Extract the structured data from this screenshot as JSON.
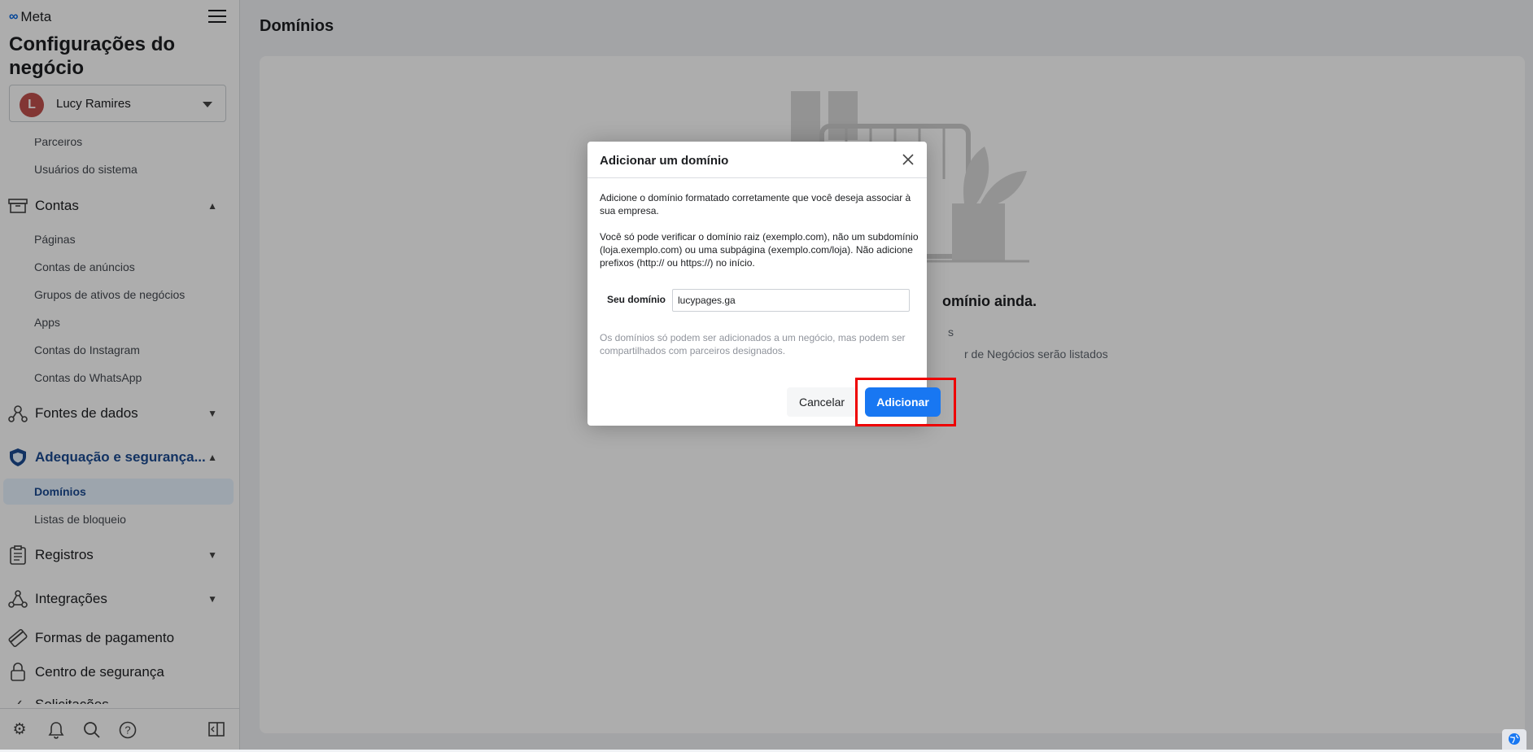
{
  "brand": {
    "name": "Meta",
    "logo_glyph": "∞"
  },
  "sidebar": {
    "title": "Configurações do negócio",
    "account": {
      "initial": "L",
      "name": "Lucy Ramires"
    },
    "items": {
      "parceiros": "Parceiros",
      "usuarios_sistema": "Usuários do sistema",
      "contas": "Contas",
      "paginas": "Páginas",
      "contas_anuncios": "Contas de anúncios",
      "grupos_ativos": "Grupos de ativos de negócios",
      "apps": "Apps",
      "contas_instagram": "Contas do Instagram",
      "contas_whatsapp": "Contas do WhatsApp",
      "fontes_dados": "Fontes de dados",
      "adequacao": "Adequação e segurança...",
      "dominios": "Domínios",
      "listas_bloqueio": "Listas de bloqueio",
      "registros": "Registros",
      "integracoes": "Integrações",
      "formas_pagamento": "Formas de pagamento",
      "centro_seguranca": "Centro de segurança",
      "solicitacoes": "Solicitações"
    },
    "icons": {
      "contas": "archive-icon",
      "fontes_dados": "data-sources-icon",
      "adequacao": "shield-icon",
      "registros": "clipboard-icon",
      "integracoes": "integrations-icon",
      "formas_pagamento": "credit-card-icon",
      "centro_seguranca": "lock-icon"
    }
  },
  "main": {
    "title": "Domínios",
    "empty_state": {
      "heading": "omínio ainda.",
      "line1": "s",
      "line2": "r de Negócios serão listados"
    }
  },
  "modal": {
    "title": "Adicionar um domínio",
    "paragraph1": "Adicione o domínio formatado corretamente que você deseja associar à sua empresa.",
    "paragraph2": "Você só pode verificar o domínio raiz (exemplo.com), não um subdomínio (loja.exemplo.com) ou uma subpágina (exemplo.com/loja). Não adicione prefixos (http:// ou https://) no início.",
    "field_label": "Seu domínio",
    "field_value": "lucypages.ga",
    "note": "Os domínios só podem ser adicionados a um negócio, mas podem ser compartilhados com parceiros designados.",
    "cancel_label": "Cancelar",
    "add_label": "Adicionar"
  },
  "colors": {
    "accent": "#1877f2",
    "active_nav": "#1b4a91",
    "highlight": "#ee0000"
  }
}
